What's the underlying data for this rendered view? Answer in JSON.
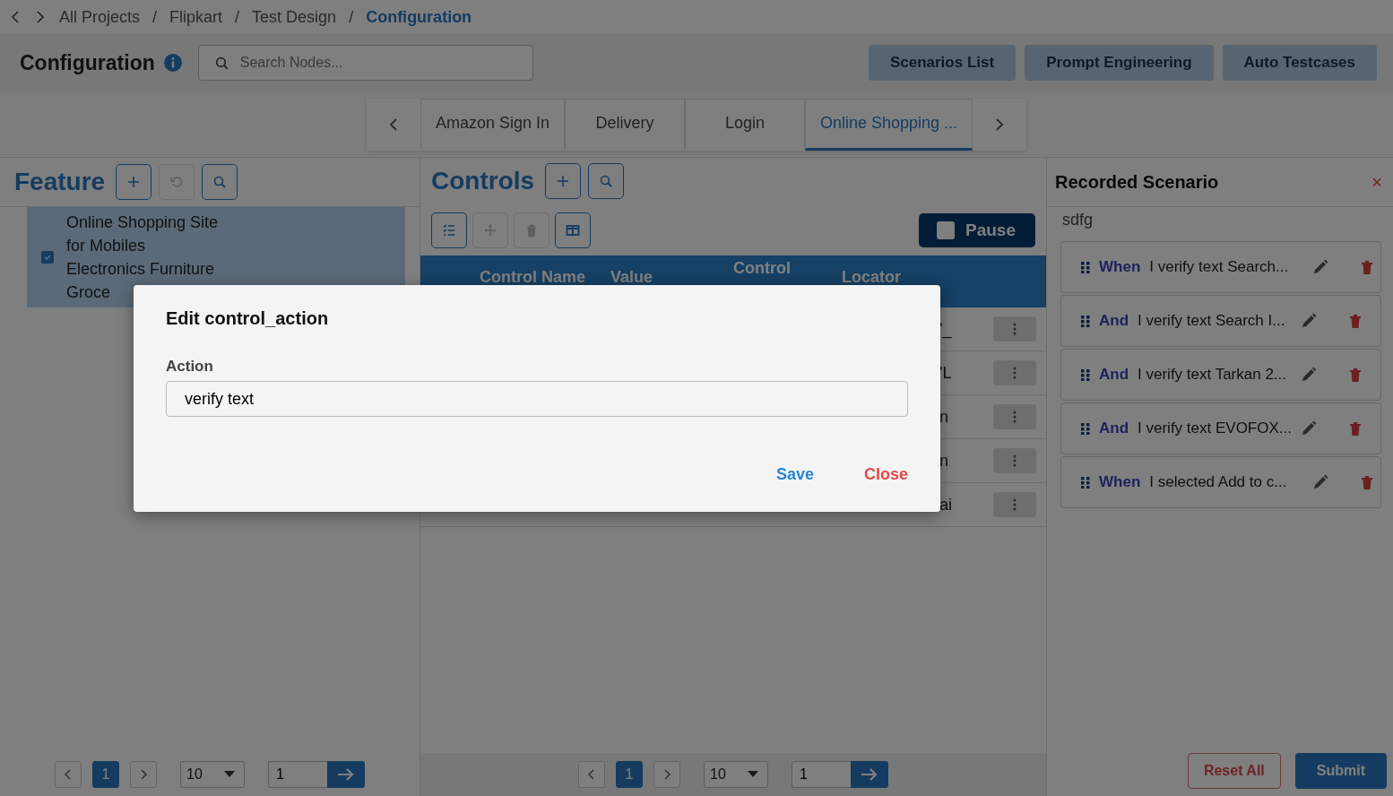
{
  "breadcrumb": [
    {
      "label": "All Projects",
      "selected": false
    },
    {
      "label": "Flipkart",
      "selected": false
    },
    {
      "label": "Test Design",
      "selected": false
    },
    {
      "label": "Configuration",
      "selected": true
    }
  ],
  "separator": "/",
  "header": {
    "title": "Configuration",
    "search": {
      "placeholder": "Search Nodes..."
    },
    "buttons": [
      "Scenarios List",
      "Prompt Engineering",
      "Auto Testcases"
    ]
  },
  "tabs": [
    {
      "label": "Amazon Sign In",
      "selected": false
    },
    {
      "label": "Delivery",
      "selected": false
    },
    {
      "label": "Login",
      "selected": false
    },
    {
      "label": "Online Shopping ...",
      "selected": true
    }
  ],
  "feature": {
    "title": "Feature",
    "tools": [
      {
        "kind": "add",
        "disabled": false
      },
      {
        "kind": "undo",
        "disabled": true
      },
      {
        "kind": "search",
        "disabled": false
      }
    ],
    "items": [
      {
        "label": "Online Shopping Site for Mobiles Electronics Furniture Groce",
        "checked": true,
        "selected": true
      }
    ],
    "pagination": {
      "page": "1",
      "page_size": "10",
      "go_to": "1"
    }
  },
  "controls": {
    "title": "Controls",
    "header_tools": [
      {
        "kind": "add",
        "disabled": false
      },
      {
        "kind": "search",
        "disabled": false
      }
    ],
    "tools": [
      {
        "kind": "checklist",
        "disabled": false
      },
      {
        "kind": "move",
        "disabled": true
      },
      {
        "kind": "delete",
        "disabled": true
      },
      {
        "kind": "columns",
        "disabled": false
      }
    ],
    "pause_button": "Pause",
    "table": {
      "columns": [
        "Control Name",
        "Value",
        "Control",
        "Locator"
      ],
      "rows": [
        {
          "column_4": "'_"
        },
        {
          "column_4": "'L"
        },
        {
          "column_4": "n"
        },
        {
          "column_4": "n"
        },
        {
          "column_4": "ai"
        }
      ]
    },
    "pagination": {
      "page": "1",
      "page_size": "10",
      "go_to": "1"
    }
  },
  "recorded": {
    "title": "Recorded Scenario",
    "close": "×",
    "name": "sdfg",
    "steps": [
      {
        "keyword": "When",
        "text": "I verify text Search..."
      },
      {
        "keyword": "And",
        "text": "I verify text Search I..."
      },
      {
        "keyword": "And",
        "text": "I verify text Tarkan 2..."
      },
      {
        "keyword": "And",
        "text": "I verify text EVOFOX..."
      },
      {
        "keyword": "When",
        "text": "I selected Add to c..."
      }
    ],
    "buttons": {
      "reset": "Reset All",
      "submit": "Submit"
    }
  },
  "dialog": {
    "title": "Edit control_action",
    "field": {
      "label": "Action",
      "value": "verify text"
    },
    "save": "Save",
    "close": "Close"
  }
}
